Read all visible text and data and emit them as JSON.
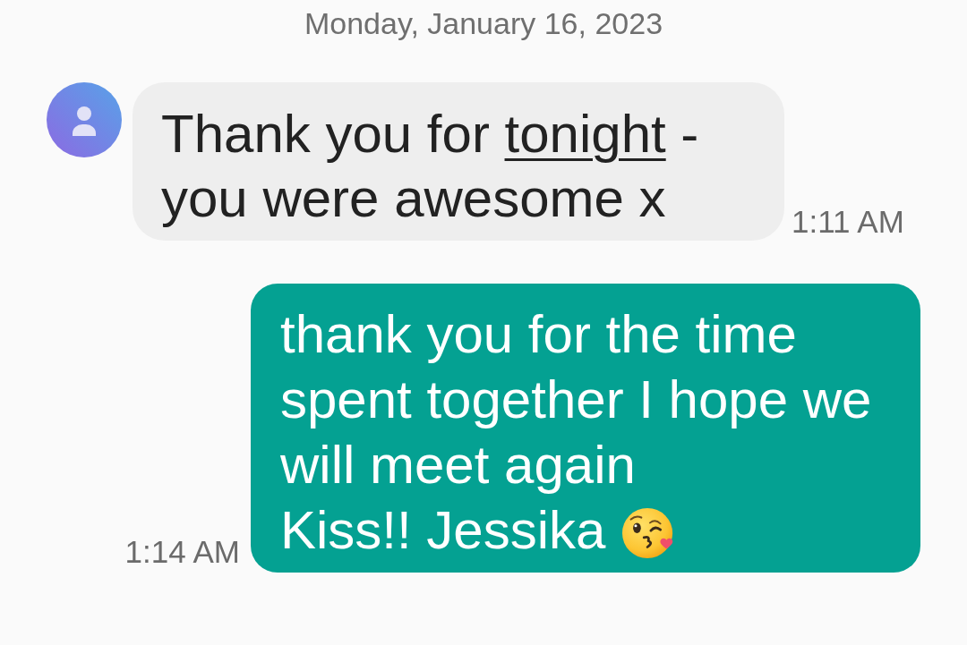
{
  "date_header": "Monday, January 16, 2023",
  "messages": [
    {
      "kind": "received",
      "lines": [
        {
          "parts": [
            {
              "kind": "text",
              "text": "Thank you for "
            },
            {
              "kind": "link",
              "text": "tonight"
            },
            {
              "kind": "text",
              "text": " - you were awesome x"
            }
          ]
        }
      ],
      "time": "1:11 AM"
    },
    {
      "kind": "sent",
      "lines": [
        {
          "parts": [
            {
              "kind": "text",
              "text": "thank you for the time spent together I hope we will meet again"
            }
          ]
        },
        {
          "parts": [
            {
              "kind": "text",
              "text": "Kiss!! Jessika"
            },
            {
              "kind": "emoji"
            }
          ]
        }
      ],
      "time": "1:14 AM"
    }
  ]
}
